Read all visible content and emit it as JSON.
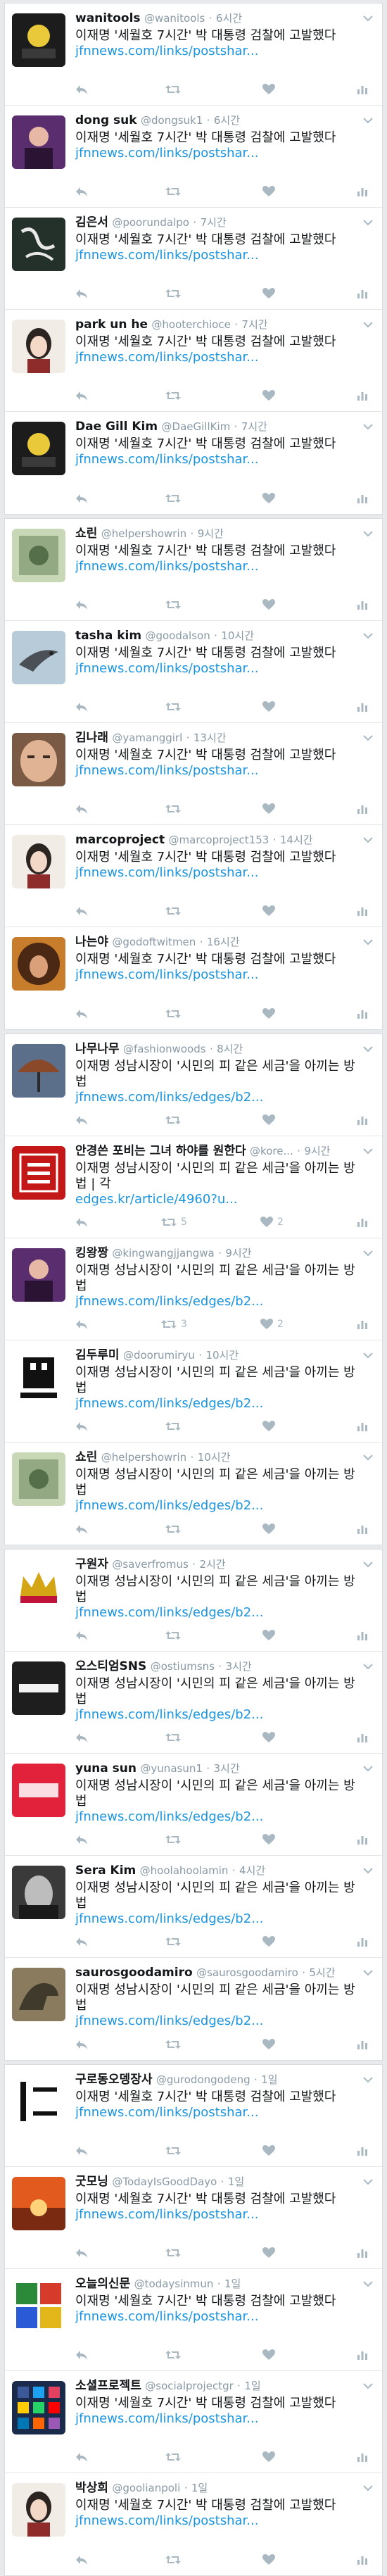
{
  "colors": {
    "link": "#1b95e0",
    "muted": "#8899a6",
    "icon": "#aab8c2"
  },
  "panels": [
    {
      "tweets": [
        {
          "name": "wanitools",
          "handle": "@wanitools",
          "time": "6시간",
          "text": "이재명 '세월호 7시간' 박 대통령 검찰에 고발했다",
          "link": "jfnnews.com/links/postshar...",
          "rt": "",
          "like": "",
          "avatar": "dark-photo"
        },
        {
          "name": "dong suk",
          "handle": "@dongsuk1",
          "time": "6시간",
          "text": "이재명 '세월호 7시간' 박 대통령 검찰에 고발했다",
          "link": "jfnnews.com/links/postshar...",
          "rt": "",
          "like": "",
          "avatar": "purple-photo"
        },
        {
          "name": "김은서",
          "handle": "@poorundalpo",
          "time": "7시간",
          "text": "이재명 '세월호 7시간' 박 대통령 검찰에 고발했다",
          "link": "jfnnews.com/links/postshar...",
          "rt": "",
          "like": "",
          "avatar": "calligraphy"
        },
        {
          "name": "park un he",
          "handle": "@hooterchioce",
          "time": "7시간",
          "text": "이재명 '세월호 7시간' 박 대통령 검찰에 고발했다",
          "link": "jfnnews.com/links/postshar...",
          "rt": "",
          "like": "",
          "avatar": "portrait-woman"
        },
        {
          "name": "Dae Gill Kim",
          "handle": "@DaeGillKim",
          "time": "7시간",
          "text": "이재명 '세월호 7시간' 박 대통령 검찰에 고발했다",
          "link": "jfnnews.com/links/postshar...",
          "rt": "",
          "like": "",
          "avatar": "dark-photo"
        }
      ]
    },
    {
      "tweets": [
        {
          "name": "쇼린",
          "handle": "@helpershowrin",
          "time": "9시간",
          "text": "이재명 '세월호 7시간' 박 대통령 검찰에 고발했다",
          "link": "jfnnews.com/links/postshar...",
          "rt": "",
          "like": "",
          "avatar": "green-photo"
        },
        {
          "name": "tasha kim",
          "handle": "@goodalson",
          "time": "10시간",
          "text": "이재명 '세월호 7시간' 박 대통령 검찰에 고발했다",
          "link": "jfnnews.com/links/postshar...",
          "rt": "",
          "like": "",
          "avatar": "bird"
        },
        {
          "name": "김나래",
          "handle": "@yamanggirl",
          "time": "13시간",
          "text": "이재명 '세월호 7시간' 박 대통령 검찰에 고발했다",
          "link": "jfnnews.com/links/postshar...",
          "rt": "",
          "like": "",
          "avatar": "face"
        },
        {
          "name": "marcoproject",
          "handle": "@marcoproject153",
          "time": "14시간",
          "text": "이재명 '세월호 7시간' 박 대통령 검찰에 고발했다",
          "link": "jfnnews.com/links/postshar...",
          "rt": "",
          "like": "",
          "avatar": "portrait-woman"
        },
        {
          "name": "나는야",
          "handle": "@godoftwitmen",
          "time": "16시간",
          "text": "이재명 '세월호 7시간' 박 대통령 검찰에 고발했다",
          "link": "jfnnews.com/links/postshar...",
          "rt": "",
          "like": "",
          "avatar": "curly"
        }
      ]
    },
    {
      "tweets": [
        {
          "name": "나무나무",
          "handle": "@fashionwoods",
          "time": "8시간",
          "text": "이재명 성남시장이 '시민의 피 같은 세금'을 아끼는 방법",
          "link": "jfnnews.com/links/edges/b2...",
          "rt": "",
          "like": "",
          "avatar": "umbrella"
        },
        {
          "name": "안경쓴 포비는 그녀 하야를 원한다",
          "handle": "@kore...",
          "time": "9시간",
          "text": "이재명 성남시장이 '시민의 피 같은 세금'을 아끼는 방법 | 각",
          "link": "edges.kr/article/4960?u...",
          "rt": "5",
          "like": "2",
          "avatar": "red-sign"
        },
        {
          "name": "킹왕짱",
          "handle": "@kingwangjjangwa",
          "time": "9시간",
          "text": "이재명 성남시장이 '시민의 피 같은 세금'을 아끼는 방법",
          "link": "jfnnews.com/links/edges/b2...",
          "rt": "3",
          "like": "2",
          "avatar": "purple-photo"
        },
        {
          "name": "김두루미",
          "handle": "@doorumiryu",
          "time": "10시간",
          "text": "이재명 성남시장이 '시민의 피 같은 세금'을 아끼는 방법",
          "link": "jfnnews.com/links/edges/b2...",
          "rt": "",
          "like": "",
          "avatar": "game-over"
        },
        {
          "name": "쇼린",
          "handle": "@helpershowrin",
          "time": "10시간",
          "text": "이재명 성남시장이 '시민의 피 같은 세금'을 아끼는 방법",
          "link": "jfnnews.com/links/edges/b2...",
          "rt": "",
          "like": "",
          "avatar": "green-photo"
        }
      ]
    },
    {
      "tweets": [
        {
          "name": "구원자",
          "handle": "@saverfromus",
          "time": "2시간",
          "text": "이재명 성남시장이 '시민의 피 같은 세금'을 아끼는 방법",
          "link": "jfnnews.com/links/edges/b2...",
          "rt": "",
          "like": "",
          "avatar": "crown"
        },
        {
          "name": "오스티엄SNS",
          "handle": "@ostiumsns",
          "time": "3시간",
          "text": "이재명 성남시장이 '시민의 피 같은 세금'을 아끼는 방법",
          "link": "jfnnews.com/links/edges/b2...",
          "rt": "",
          "like": "",
          "avatar": "ostium"
        },
        {
          "name": "yuna sun",
          "handle": "@yunasun1",
          "time": "3시간",
          "text": "이재명 성남시장이 '시민의 피 같은 세금'을 아끼는 방법",
          "link": "jfnnews.com/links/edges/b2...",
          "rt": "",
          "like": "",
          "avatar": "yuna"
        },
        {
          "name": "Sera Kim",
          "handle": "@hoolahoolamin",
          "time": "4시간",
          "text": "이재명 성남시장이 '시민의 피 같은 세금'을 아끼는 방법",
          "link": "jfnnews.com/links/edges/b2...",
          "rt": "",
          "like": "",
          "avatar": "bw-face"
        },
        {
          "name": "saurosgoodamiro",
          "handle": "@saurosgoodamiro",
          "time": "5시간",
          "text": "이재명 성남시장이 '시민의 피 같은 세금'을 아끼는 방법",
          "link": "jfnnews.com/links/edges/b2...",
          "rt": "",
          "like": "",
          "avatar": "dino"
        }
      ]
    },
    {
      "tweets": [
        {
          "name": "구로동오뎅장사",
          "handle": "@gurodongodeng",
          "time": "1일",
          "text": "이재명 '세월호 7시간' 박 대통령 검찰에 고발했다",
          "link": "jfnnews.com/links/postshar...",
          "rt": "",
          "like": "",
          "avatar": "glyph"
        },
        {
          "name": "굿모닝",
          "handle": "@TodayIsGoodDayo",
          "time": "1일",
          "text": "이재명 '세월호 7시간' 박 대통령 검찰에 고발했다",
          "link": "jfnnews.com/links/postshar...",
          "rt": "",
          "like": "",
          "avatar": "sunset"
        },
        {
          "name": "오늘의신문",
          "handle": "@todaysinmun",
          "time": "1일",
          "text": "이재명 '세월호 7시간' 박 대통령 검찰에 고발했다",
          "link": "jfnnews.com/links/postshar...",
          "rt": "",
          "like": "",
          "avatar": "colorful"
        },
        {
          "name": "소셜프로젝트",
          "handle": "@socialprojectgr",
          "time": "1일",
          "text": "이재명 '세월호 7시간' 박 대통령 검찰에 고발했다",
          "link": "jfnnews.com/links/postshar...",
          "rt": "",
          "like": "",
          "avatar": "apps"
        },
        {
          "name": "박상희",
          "handle": "@goolianpoli",
          "time": "1일",
          "text": "이재명 '세월호 7시간' 박 대통령 검찰에 고발했다",
          "link": "jfnnews.com/links/postshar...",
          "rt": "",
          "like": "",
          "avatar": "portrait-woman"
        }
      ]
    }
  ]
}
